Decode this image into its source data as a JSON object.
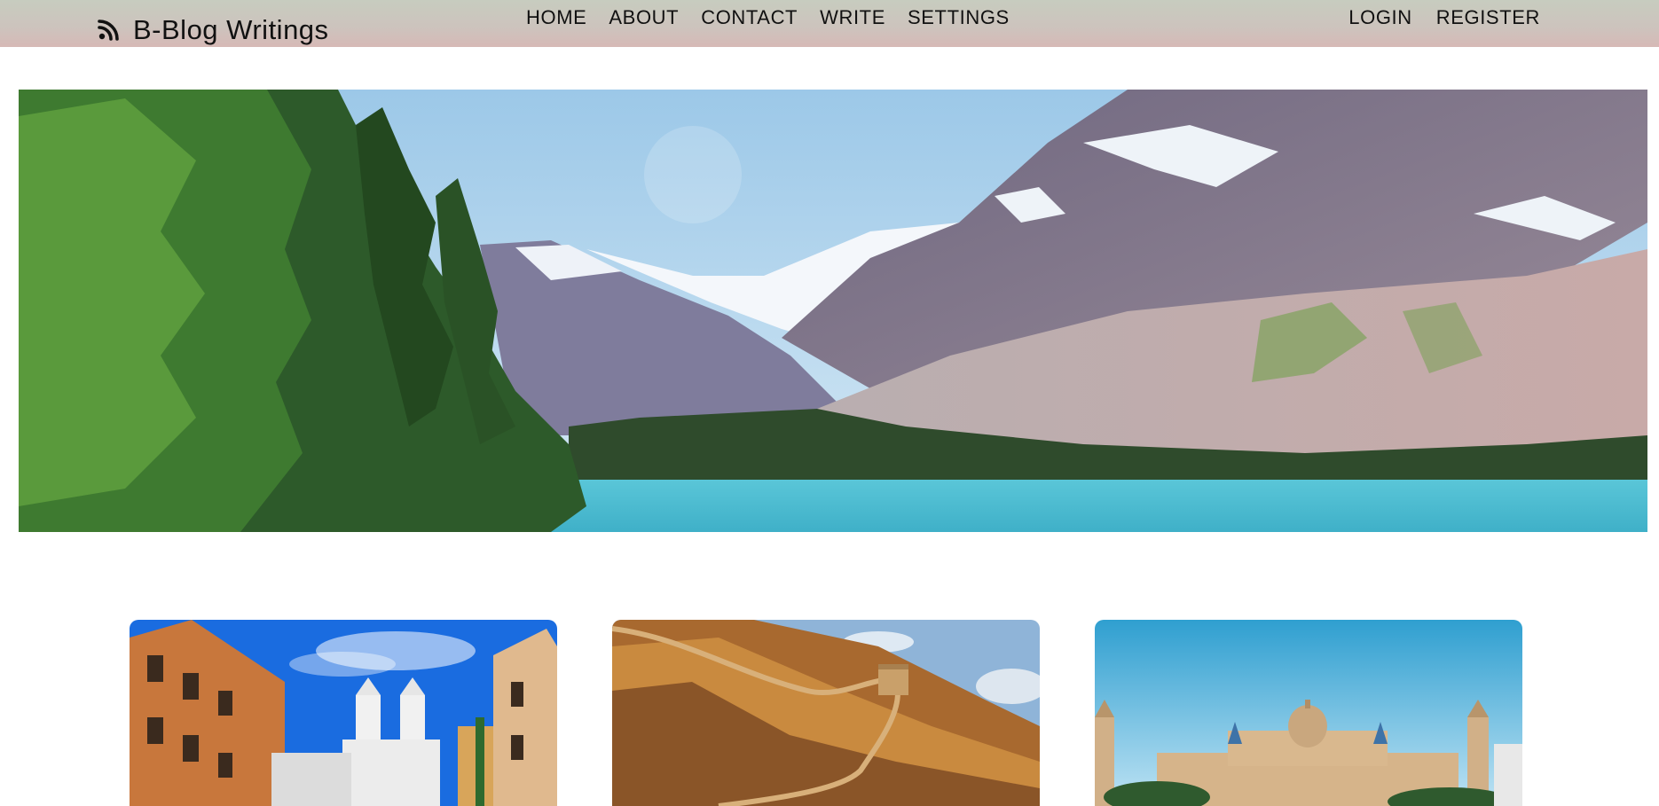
{
  "brand": {
    "title": "B-Blog Writings",
    "icon": "rss-feed-icon"
  },
  "nav": {
    "home": "HOME",
    "about": "ABOUT",
    "contact": "CONTACT",
    "write": "WRITE",
    "settings": "SETTINGS"
  },
  "auth": {
    "login": "LOGIN",
    "register": "REGISTER"
  },
  "hero": {
    "subject": "mountain lake with pine forest"
  },
  "posts": [
    {
      "image": "rome-spanish-steps-church"
    },
    {
      "image": "great-wall-of-china"
    },
    {
      "image": "barcelona-palace"
    }
  ],
  "colors": {
    "topbar_top": "#c7ccbf",
    "topbar_bottom": "#d6b9b6",
    "text": "#111111"
  }
}
